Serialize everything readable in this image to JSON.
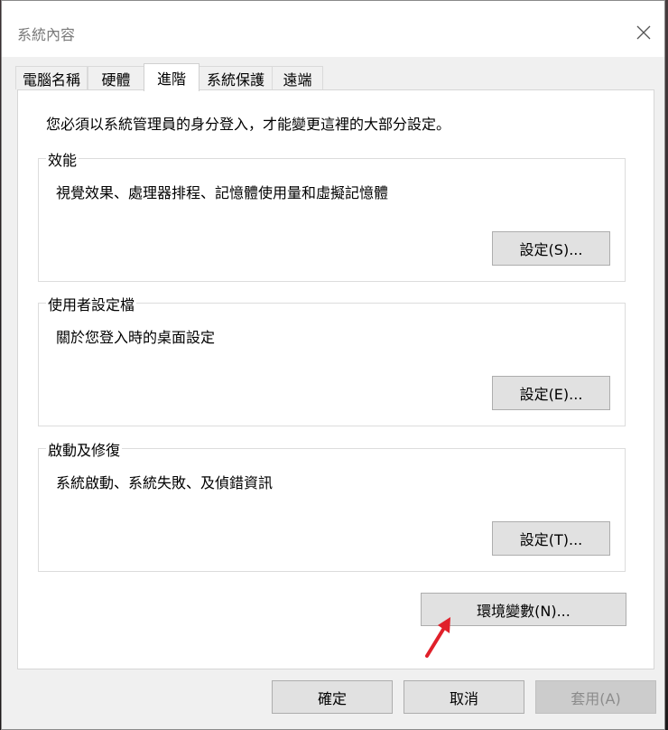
{
  "window": {
    "title": "系統內容",
    "close_symbol": "✕"
  },
  "tabs": [
    {
      "label": "電腦名稱",
      "active": false
    },
    {
      "label": "硬體",
      "active": false
    },
    {
      "label": "進階",
      "active": true
    },
    {
      "label": "系統保護",
      "active": false
    },
    {
      "label": "遠端",
      "active": false
    }
  ],
  "advanced": {
    "admin_note": "您必須以系統管理員的身分登入，才能變更這裡的大部分設定。",
    "performance": {
      "label": "效能",
      "description": "視覺效果、處理器排程、記憶體使用量和虛擬記憶體",
      "button": "設定(S)..."
    },
    "user_profiles": {
      "label": "使用者設定檔",
      "description": "關於您登入時的桌面設定",
      "button": "設定(E)..."
    },
    "startup_recovery": {
      "label": "啟動及修復",
      "description": "系統啟動、系統失敗、及偵錯資訊",
      "button": "設定(T)..."
    },
    "env_button": "環境變數(N)..."
  },
  "footer": {
    "ok": "確定",
    "cancel": "取消",
    "apply": "套用(A)",
    "apply_disabled": true
  },
  "colors": {
    "annotation_arrow": "#e0202a",
    "button_face": "#e1e1e1",
    "window_bg": "#f0f0f0"
  },
  "icons": {
    "close": "close-icon",
    "arrow": "red-arrow-annotation"
  }
}
